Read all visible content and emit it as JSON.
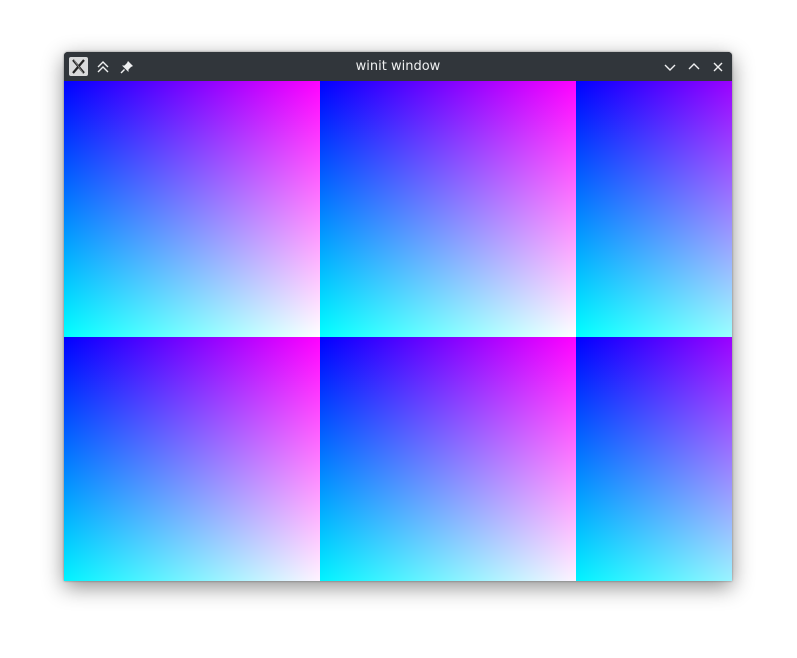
{
  "window": {
    "title": "winit window",
    "icons": {
      "app": "x11-app-icon",
      "keep_above": "keep-above-icon",
      "pin": "pin-icon",
      "minimize": "minimize-icon",
      "maximize": "maximize-icon",
      "close": "close-icon"
    }
  },
  "content": {
    "pattern": "rgb-gradient-tiles",
    "tile_colors": {
      "top_left": "#0000ff",
      "top_right": "#ff0080",
      "bottom_left": "#00ffff",
      "bottom_right": "#ffff00",
      "center": "#808080"
    }
  }
}
